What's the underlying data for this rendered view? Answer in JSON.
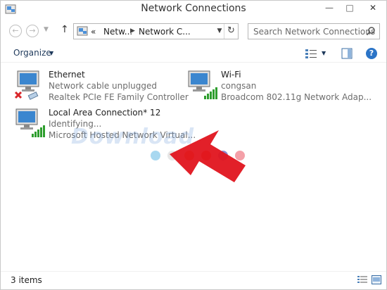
{
  "window": {
    "title": "Network Connections"
  },
  "nav": {
    "back_icon": "back-arrow-icon",
    "forward_icon": "forward-arrow-icon",
    "address_segments": [
      "«",
      "Netw...",
      "Network C..."
    ],
    "search_placeholder": "Search Network Connections"
  },
  "toolbar": {
    "organize_label": "Organize"
  },
  "items": [
    {
      "name": "Ethernet",
      "status": "Network cable unplugged",
      "device": "Realtek PCIe FE Family Controller",
      "icon": "ethernet-disconnected-icon"
    },
    {
      "name": "Wi-Fi",
      "status": "congsan",
      "device": "Broadcom 802.11g Network Adap...",
      "icon": "wifi-adapter-icon"
    },
    {
      "name": "Local Area Connection* 12",
      "status": "Identifying...",
      "device": "Microsoft Hosted Network Virtual...",
      "icon": "wireless-adapter-icon"
    }
  ],
  "watermark": "Download",
  "status_bar": {
    "count": "3 items"
  },
  "colors": {
    "accent": "#1e395b",
    "arrow": "#e0141e",
    "signal": "#2e9e2e",
    "disconnect": "#d9262a",
    "dots": [
      "#a8d8f0",
      "#e6e6e6",
      "#f08a2a",
      "#f06a2a",
      "#8c8ad0",
      "#f4a0a8"
    ]
  }
}
